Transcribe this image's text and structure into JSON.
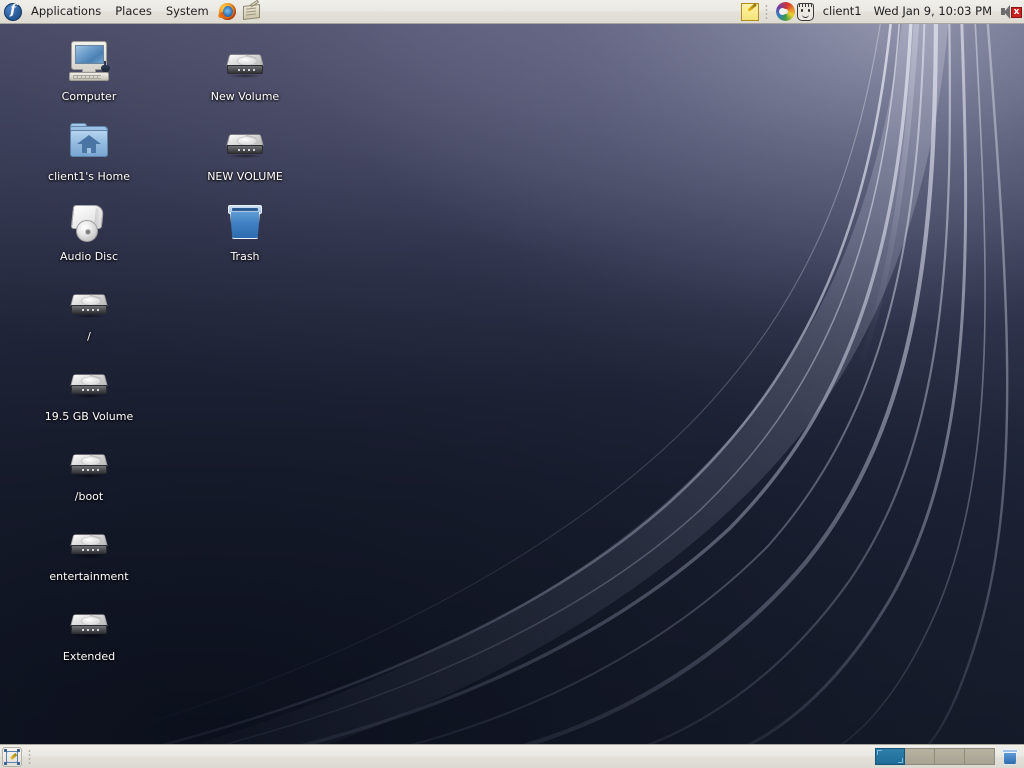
{
  "os": {
    "name": "Fedora GNOME Desktop",
    "wallpaper_colors": {
      "top": "#4d4e67",
      "mid": "#282d44",
      "bottom": "#161b2a",
      "streak": "#c8cbdd"
    },
    "panel_bg": "#eae8e2",
    "panel_text": "#1d1d1d"
  },
  "top_panel": {
    "logo_icon": "fedora-logo-icon",
    "menus": [
      {
        "label": "Applications",
        "name": "menu-applications"
      },
      {
        "label": "Places",
        "name": "menu-places"
      },
      {
        "label": "System",
        "name": "menu-system"
      }
    ],
    "launchers": [
      {
        "name": "firefox-launcher",
        "icon": "firefox-icon",
        "title": "Firefox Web Browser"
      },
      {
        "name": "evolution-launcher",
        "icon": "mail-document-icon",
        "title": "Evolution Mail"
      }
    ],
    "tray": {
      "note_icon": "sticky-note-icon",
      "swirl_icon": "color-swirl-icon",
      "face_icon": "user-face-icon",
      "username": "client1",
      "clock": "Wed Jan  9, 10:03 PM",
      "volume_icon": "speaker-muted-icon",
      "volume_muted_mark": "x"
    }
  },
  "desktop": {
    "icons": [
      {
        "label": "Computer",
        "type": "computer",
        "name": "desktop-icon-computer",
        "col": 0,
        "row": 0
      },
      {
        "label": "client1's Home",
        "type": "home",
        "name": "desktop-icon-home",
        "col": 0,
        "row": 1
      },
      {
        "label": "Audio Disc",
        "type": "cd",
        "name": "desktop-icon-audio-disc",
        "col": 0,
        "row": 2
      },
      {
        "label": "/",
        "type": "drive",
        "name": "desktop-icon-root",
        "col": 0,
        "row": 3
      },
      {
        "label": "19.5 GB Volume",
        "type": "drive",
        "name": "desktop-icon-19gb-volume",
        "col": 0,
        "row": 4
      },
      {
        "label": "/boot",
        "type": "drive",
        "name": "desktop-icon-boot",
        "col": 0,
        "row": 5
      },
      {
        "label": "entertainment",
        "type": "drive",
        "name": "desktop-icon-entertainment",
        "col": 0,
        "row": 6
      },
      {
        "label": "Extended",
        "type": "drive",
        "name": "desktop-icon-extended",
        "col": 0,
        "row": 7
      },
      {
        "label": "New Volume",
        "type": "drive",
        "name": "desktop-icon-new-volume",
        "col": 1,
        "row": 0
      },
      {
        "label": "NEW VOLUME",
        "type": "drive",
        "name": "desktop-icon-new-volume-caps",
        "col": 1,
        "row": 1
      },
      {
        "label": "Trash",
        "type": "trash",
        "name": "desktop-icon-trash",
        "col": 1,
        "row": 2
      }
    ]
  },
  "bottom_panel": {
    "show_desktop_icon": "show-desktop-icon",
    "window_list": [],
    "workspaces": [
      {
        "name": "workspace-1",
        "active": true
      },
      {
        "name": "workspace-2",
        "active": false
      },
      {
        "name": "workspace-3",
        "active": false
      },
      {
        "name": "workspace-4",
        "active": false
      }
    ],
    "trash_icon": "trash-icon"
  }
}
